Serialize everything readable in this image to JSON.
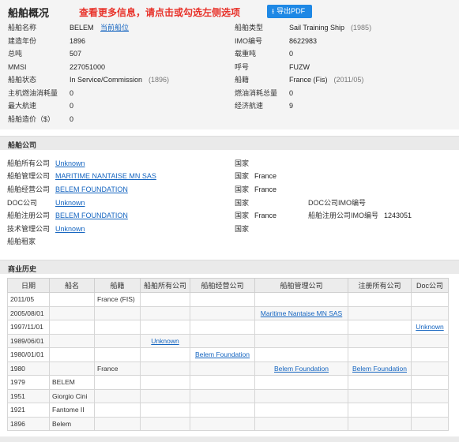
{
  "header": {
    "title": "船舶概况",
    "notice": "查看更多信息，请点击或勾选左侧选项",
    "pdf_button": "导出PDF"
  },
  "overview": {
    "name_label": "船舶名称",
    "name": "BELEM",
    "position_link": "当前船位",
    "type_label": "船舶类型",
    "type": "Sail Training Ship",
    "type_year": "(1985)",
    "built_label": "建造年份",
    "built": "1896",
    "imo_label": "IMO编号",
    "imo": "8622983",
    "gt_label": "总吨",
    "gt": "507",
    "dwt_label": "载重吨",
    "dwt": "0",
    "mmsi_label": "MMSI",
    "mmsi": "227051000",
    "callsign_label": "呼号",
    "callsign": "FUZW",
    "status_label": "船舶状态",
    "status": "In Service/Commission",
    "status_year": "(1896)",
    "flag_label": "船籍",
    "flag": "France (Fis)",
    "flag_date": "(2011/05)",
    "main_fuel_label": "主机燃油消耗量",
    "main_fuel": "0",
    "aux_fuel_label": "燃油消耗总量",
    "aux_fuel": "0",
    "max_speed_label": "最大航速",
    "max_speed": "0",
    "eco_speed_label": "经济航速",
    "eco_speed": "9",
    "cost_label": "船舶造价（$）",
    "cost": "0"
  },
  "companies": {
    "section_title": "船舶公司",
    "country_label": "国家",
    "doc_imo_label": "DOC公司IMO编号",
    "reg_imo_label": "船舶注册公司IMO编号",
    "reg_imo": "1243051",
    "rows": [
      {
        "label": "船舶所有公司",
        "name": "Unknown",
        "country": ""
      },
      {
        "label": "船舶管理公司",
        "name": "MARITIME NANTAISE MN SAS",
        "country": "France"
      },
      {
        "label": "船舶经营公司",
        "name": "BELEM FOUNDATION",
        "country": "France"
      },
      {
        "label": "DOC公司",
        "name": "Unknown",
        "country": ""
      },
      {
        "label": "船舶注册公司",
        "name": "BELEM FOUNDATION",
        "country": "France"
      },
      {
        "label": "技术管理公司",
        "name": "Unknown",
        "country": ""
      },
      {
        "label": "船舶租家",
        "name": "",
        "country": ""
      }
    ]
  },
  "history": {
    "section_title": "商业历史",
    "columns": [
      "日期",
      "船名",
      "船籍",
      "船舶所有公司",
      "船舶经营公司",
      "船舶管理公司",
      "注册所有公司",
      "Doc公司"
    ],
    "rows": [
      [
        "2011/05",
        "",
        "France (FIS)",
        "",
        "",
        "",
        "",
        ""
      ],
      [
        "2005/08/01",
        "",
        "",
        "",
        "",
        "Maritime Nantaise MN SAS",
        "",
        ""
      ],
      [
        "1997/11/01",
        "",
        "",
        "",
        "",
        "",
        "",
        "Unknown"
      ],
      [
        "1989/06/01",
        "",
        "",
        "Unknown",
        "",
        "",
        "",
        ""
      ],
      [
        "1980/01/01",
        "",
        "",
        "",
        "Belem Foundation",
        "",
        "",
        ""
      ],
      [
        "1980",
        "",
        "France",
        "",
        "",
        "Belem Foundation",
        "Belem Foundation",
        ""
      ],
      [
        "1979",
        "BELEM",
        "",
        "",
        "",
        "",
        "",
        ""
      ],
      [
        "1951",
        "Giorgio Cini",
        "",
        "",
        "",
        "",
        "",
        ""
      ],
      [
        "1921",
        "Fantome II",
        "",
        "",
        "",
        "",
        "",
        ""
      ],
      [
        "1896",
        "Belem",
        "",
        "",
        "",
        "",
        "",
        ""
      ]
    ]
  }
}
